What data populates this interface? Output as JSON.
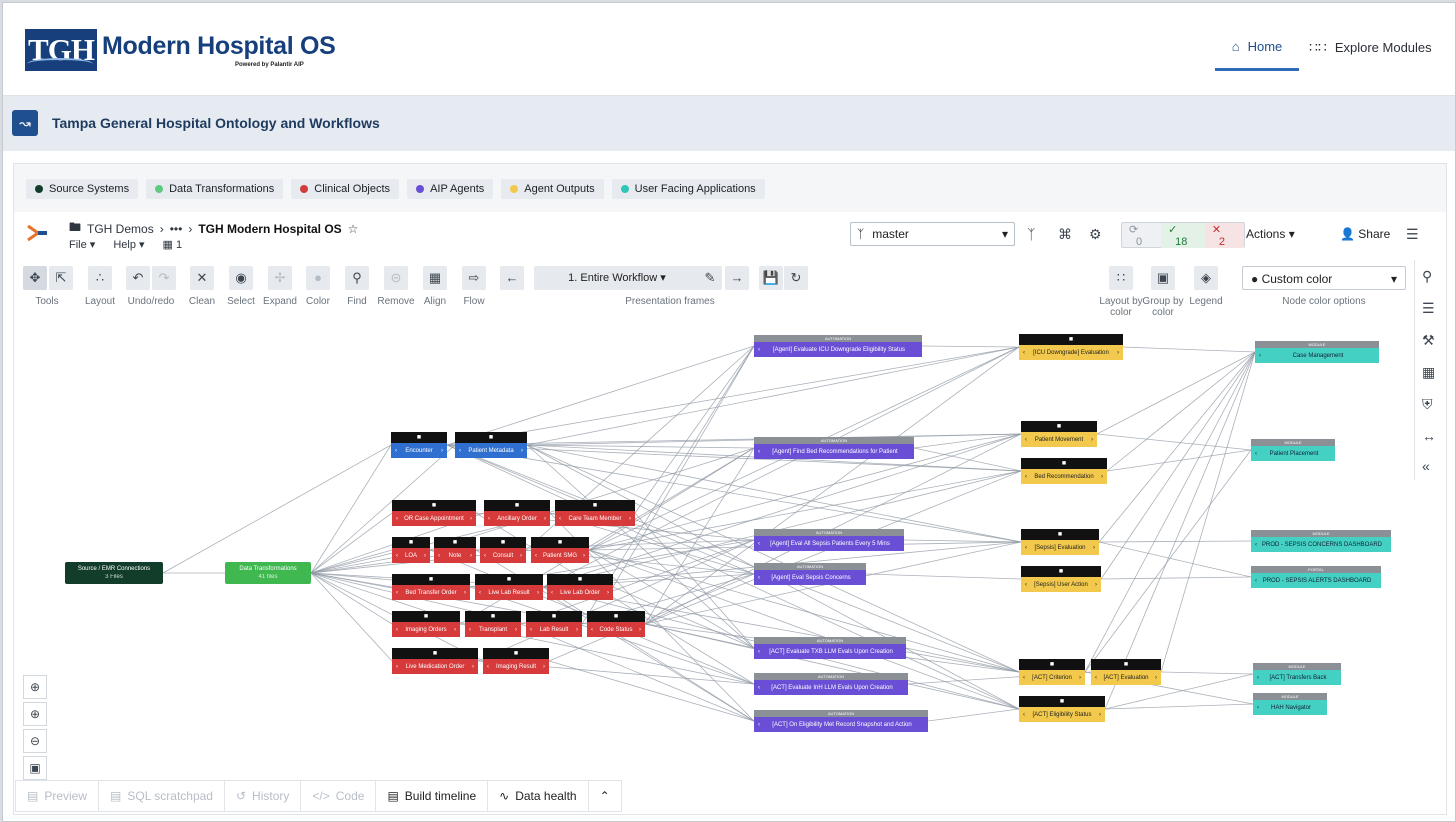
{
  "header": {
    "logo_text": "TGH",
    "app_title": "Modern Hospital OS",
    "powered_by": "Powered by Palantir AIP",
    "nav_home": "Home",
    "nav_explore": "Explore Modules"
  },
  "banner": {
    "title": "Tampa General Hospital Ontology and Workflows"
  },
  "legend": [
    {
      "label": "Source Systems",
      "color": "#123d2a"
    },
    {
      "label": "Data Transformations",
      "color": "#5fc97f"
    },
    {
      "label": "Clinical Objects",
      "color": "#d23b3b"
    },
    {
      "label": "AIP Agents",
      "color": "#6a4fd6"
    },
    {
      "label": "Agent Outputs",
      "color": "#f2c94c"
    },
    {
      "label": "User Facing Applications",
      "color": "#2fc5b9"
    }
  ],
  "breadcrumb": {
    "root": "TGH Demos",
    "ellipsis": "•••",
    "current": "TGH Modern Hospital OS"
  },
  "menus": {
    "file": "File",
    "help": "Help",
    "count": "1"
  },
  "branch": {
    "name": "master"
  },
  "checks": {
    "pending": "0",
    "passed": "18",
    "failed": "2"
  },
  "actions_label": "Actions",
  "share_label": "Share",
  "toolbar": {
    "tools": "Tools",
    "layout": "Layout",
    "undo_redo": "Undo/redo",
    "clean": "Clean",
    "select": "Select",
    "expand": "Expand",
    "color": "Color",
    "find": "Find",
    "remove": "Remove",
    "align": "Align",
    "flow": "Flow",
    "frame_value": "1. Entire Workflow",
    "frames_label": "Presentation frames",
    "layout_by_color": "Layout by color",
    "group_by_color": "Group by color",
    "legend": "Legend",
    "node_color_value": "Custom color",
    "node_color_label": "Node color options"
  },
  "nodes": {
    "source": {
      "head": "Source / EMR Connections",
      "sub": "3 Files"
    },
    "transform": {
      "head": "Data Transformations",
      "sub": "41 files"
    },
    "encounter": "Encounter",
    "patient_metadata": "Patient Metadata",
    "or_case": "OR Case Appointment",
    "ancillary": "Ancillary Order",
    "care_team": "Care Team Member",
    "loa": "LOA",
    "note": "Note",
    "consult": "Consult",
    "patient_smg": "Patient SMG",
    "bed_transfer": "Bed Transfer Order",
    "live_lab_result": "Live Lab Result",
    "live_lab_order": "Live Lab Order",
    "imaging_orders": "Imaging Orders",
    "transplant": "Transplant",
    "lab_result": "Lab Result",
    "code_status": "Code Status",
    "live_medication": "Live Medication Order",
    "imaging_result": "Imaging Result",
    "agent_icu": "[Agent] Evaluate ICU Downgrade Eligibility Status",
    "agent_bed": "[Agent] Find Bed Recommendations for Patient",
    "agent_sepsis_all": "[Agent] Eval All Sepsis Patients Every 5 Mins",
    "agent_sepsis": "[Agent] Eval Sepsis Concerns",
    "act_txb": "[ACT] Evaluate TXB LLM Evals Upon Creation",
    "act_inhl": "[ACT] Evaluate InH LLM Evals Upon Creation",
    "act_snapshot": "[ACT] On Eligibility Met Record Snapshot and Action",
    "automation_tag": "AUTOMATION",
    "icu_eval": "[ICU Downgrade] Evaluation",
    "patient_movement": "Patient Movement",
    "bed_rec": "Bed Recommendation",
    "sepsis_eval": "[Sepsis] Evaluation",
    "sepsis_user": "[Sepsis] User Action",
    "act_criterion": "[ACT] Criterion",
    "act_evaluation": "[ACT] Evaluation",
    "act_eligibility": "[ACT] Eligibility Status",
    "case_mgmt": "Case Management",
    "patient_placement": "Patient Placement",
    "sepsis_dash": "PROD - SEPSIS CONCERNS DASHBOARD",
    "sepsis_alerts": "PROD - SEPSIS ALERTS DASHBOARD",
    "transfers_back": "[ACT] Transfers Back",
    "hah_nav": "HAH Navigator",
    "app_tag_module": "MODULE",
    "app_tag_portal": "PORTAL"
  },
  "bottom_tabs": {
    "preview": "Preview",
    "sql": "SQL scratchpad",
    "history": "History",
    "code": "Code",
    "build": "Build timeline",
    "health": "Data health"
  }
}
